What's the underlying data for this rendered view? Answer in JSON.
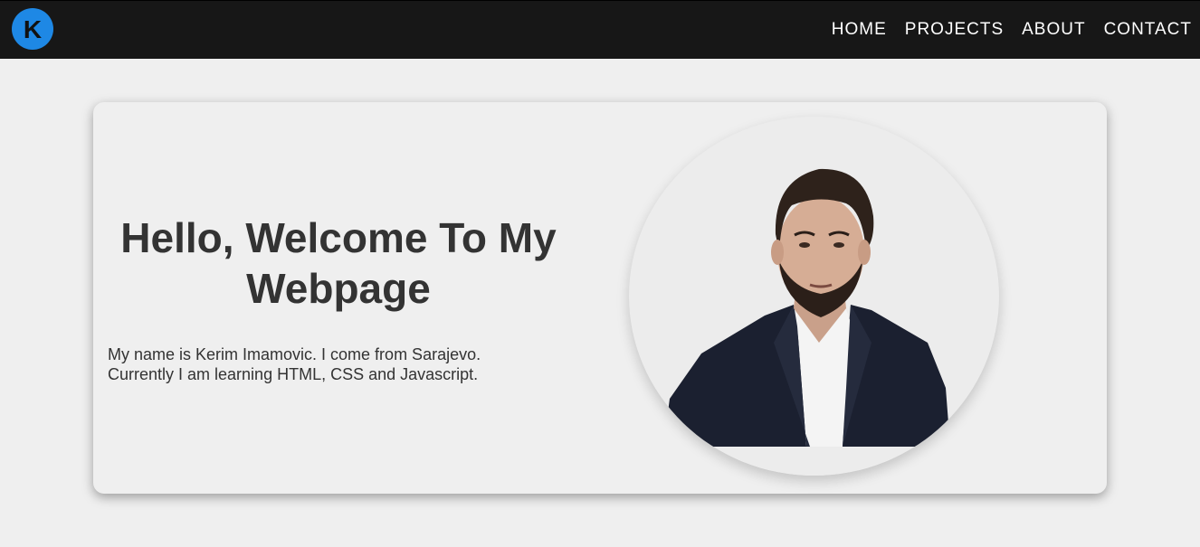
{
  "nav": {
    "logo_letter": "K",
    "links": [
      "HOME",
      "PROJECTS",
      "ABOUT",
      "CONTACT"
    ]
  },
  "hero": {
    "title": "Hello, Welcome To My Webpage",
    "text": "My name is Kerim Imamovic. I come from Sarajevo. Currently I am learning HTML, CSS and Javascript."
  },
  "colors": {
    "navbar": "#171717",
    "logo_accent": "#1e88e5",
    "page_background": "#efefef",
    "text": "#333333"
  }
}
